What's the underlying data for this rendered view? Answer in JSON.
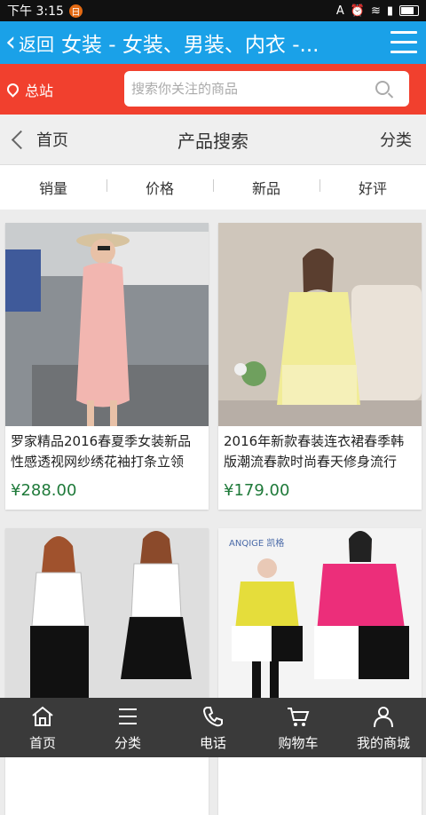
{
  "status": {
    "time": "下午 3:15",
    "notif_badge": "日"
  },
  "header": {
    "back_label": "返回",
    "title": "女装 - 女装、男装、内衣 -..."
  },
  "location": {
    "label": "总站"
  },
  "search": {
    "placeholder": "搜索你关注的商品"
  },
  "page": {
    "home_label": "首页",
    "title": "产品搜索",
    "category_label": "分类"
  },
  "sort_tabs": [
    "销量",
    "价格",
    "新品",
    "好评"
  ],
  "products": [
    {
      "name": "罗家精品2016春夏季女装新品性感透视网纱绣花袖打条立领",
      "price": "¥288.00"
    },
    {
      "name": "2016年新款春装连衣裙春季韩版潮流春款时尚春天修身流行",
      "price": "¥179.00"
    },
    {
      "name": "",
      "price": ""
    },
    {
      "name": "",
      "price": ""
    }
  ],
  "product_image_brand": "ANQIGE 凯格",
  "nav": [
    "首页",
    "分类",
    "电话",
    "购物车",
    "我的商城"
  ],
  "colors": {
    "title_bar": "#1aa1e8",
    "search_bar": "#f1402e",
    "price": "#1f7a3a",
    "tab_bar": "#3a3a3a"
  }
}
